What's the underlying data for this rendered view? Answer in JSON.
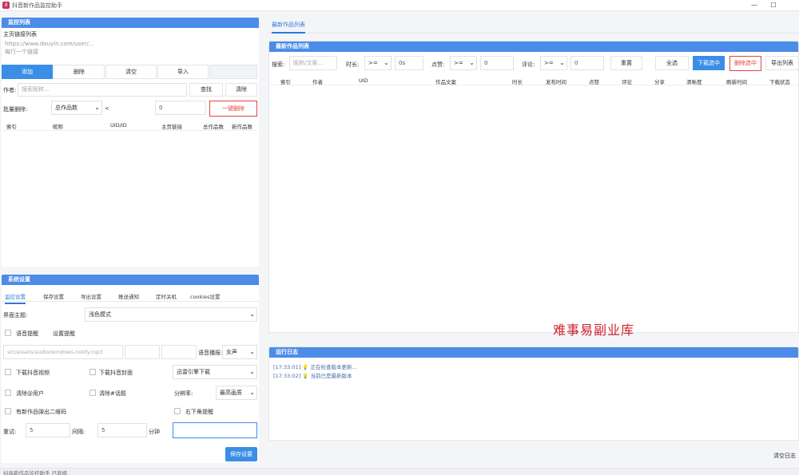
{
  "window": {
    "title": "抖音新作品监控助手",
    "min_glyph": "—",
    "max_glyph": "☐"
  },
  "monitor": {
    "header": "监控列表",
    "url_label": "主页链接列表",
    "url_placeholder": "https://www.douyin.com/user/...\n每行一个链接",
    "buttons": {
      "add": "添加",
      "delete": "删除",
      "clear": "清空",
      "import": "导入"
    },
    "author_label": "作者:",
    "author_placeholder": "搜索昵称...",
    "find": "查找",
    "clear_search": "清除",
    "bulk_label": "批量删除:",
    "bulk_field": "总作品数",
    "bulk_op": "<",
    "bulk_value": "0",
    "bulk_button": "一键删除",
    "columns": [
      "索引",
      "昵称",
      "UID/ID",
      "主页链接",
      "总作品数",
      "新作品数"
    ]
  },
  "settings": {
    "header": "系统设置",
    "tabs": [
      "监控设置",
      "保存设置",
      "导出设置",
      "推送通知",
      "定时关机",
      "cookies设置"
    ],
    "theme_label": "界面主题:",
    "theme_value": "浅色模式",
    "sound_remind": "语音提醒",
    "sound_set": "设置提醒",
    "sound_path": "src/assets/audio/windows-notify.mp3",
    "voice_label": "语音播报:",
    "voice_value": "女声",
    "download_video": "下载抖音视频",
    "download_cover": "下载抖音封面",
    "engine_value": "迅雷引擎下载",
    "remove_at": "清除@用户",
    "remove_topic": "清除#话题",
    "resolution_label": "分辨率:",
    "resolution_value": "最高画质",
    "qr_popup": "有新作品弹出二维码",
    "corner_popup": "右下角提醒",
    "retry_label": "重试:",
    "retry_value": "5",
    "interval_label": "间隔:",
    "interval_value": "5",
    "minutes_label": "分钟",
    "save_button": "保存设置"
  },
  "main": {
    "tab": "最新作品列表",
    "header": "最新作品列表",
    "search_label": "搜索:",
    "search_placeholder": "昵称/文案...",
    "duration_label": "时长:",
    "duration_op": ">=",
    "duration_value": "0s",
    "likes_label": "点赞:",
    "likes_op": ">=",
    "likes_value": "0",
    "comments_label": "评论:",
    "comments_op": ">=",
    "comments_value": "0",
    "reset": "重置",
    "select_all": "全选",
    "download_selected": "下载选中",
    "delete_selected": "删除选中",
    "export_list": "导出列表",
    "columns": [
      "索引",
      "作者",
      "UID",
      "作品文案",
      "时长",
      "发布时间",
      "点赞",
      "评论",
      "分享",
      "清晰度",
      "刷新时间",
      "下载状态"
    ],
    "watermark": "难事易副业库"
  },
  "log": {
    "header": "运行日志",
    "lines": [
      {
        "time": "[17:33:01]",
        "text": "正在检查版本更新..."
      },
      {
        "time": "[17:33:02]",
        "text": "当前已是最新版本"
      }
    ],
    "clear": "清空日志"
  },
  "status_text": "抖音新作品监控助手 已就绪"
}
